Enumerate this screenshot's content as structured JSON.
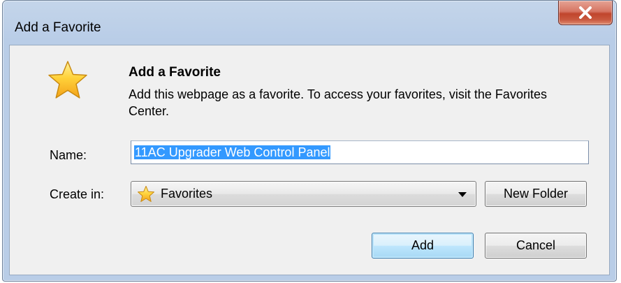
{
  "window": {
    "title": "Add a Favorite",
    "close_label": "X"
  },
  "header": {
    "heading": "Add a Favorite",
    "description": "Add this webpage as a favorite. To access your favorites, visit the Favorites Center."
  },
  "form": {
    "name_label": "Name:",
    "name_value": "11AC Upgrader Web Control Panel",
    "create_in_label": "Create in:",
    "create_in_value": "Favorites",
    "new_folder_label": "New Folder"
  },
  "actions": {
    "add_label": "Add",
    "cancel_label": "Cancel"
  },
  "icons": {
    "header_icon": "star-icon",
    "folder_icon": "star-icon",
    "dropdown_icon": "chevron-down-icon"
  },
  "colors": {
    "selection": "#3399ff",
    "close_button": "#c9593f",
    "star_fill": "#ffc72c"
  }
}
